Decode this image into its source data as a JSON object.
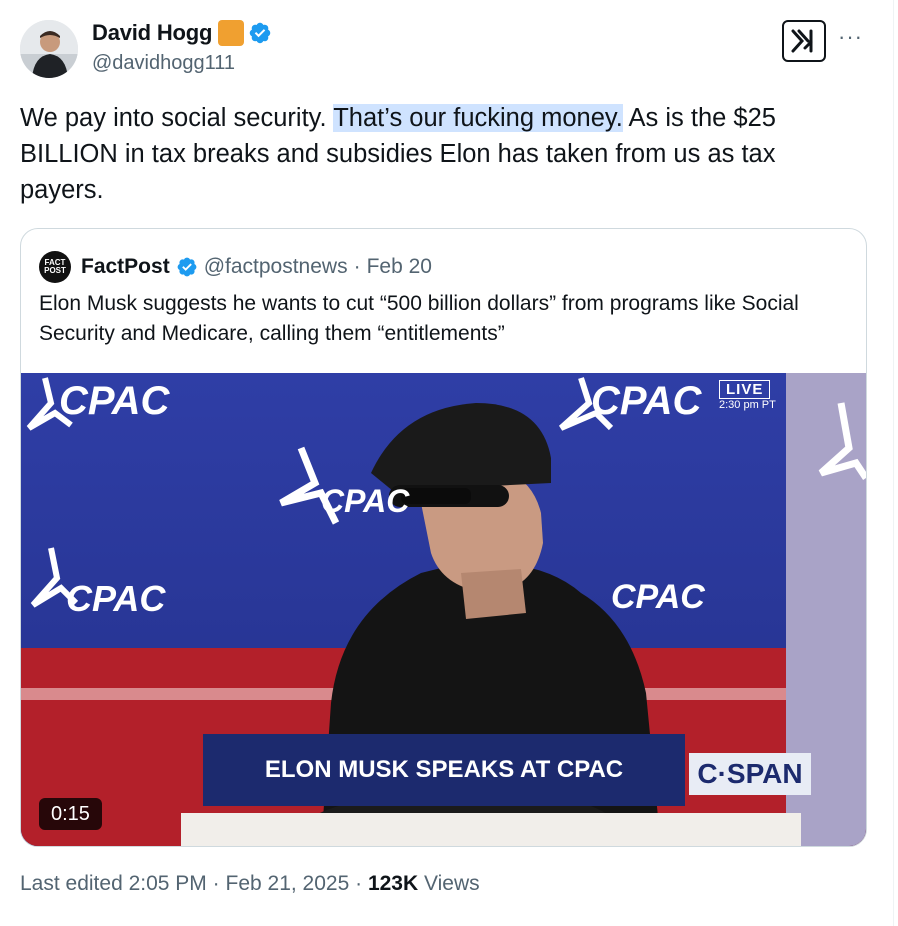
{
  "author": {
    "display_name": "David Hogg",
    "handle": "@davidhogg111",
    "verified_icon": "verified-badge-icon",
    "badge_color": "#F0A030",
    "verified_color": "#1D9BF0"
  },
  "tweet": {
    "text_before": "We pay into social security. ",
    "text_highlight": "That’s our fucking money.",
    "text_after": " As is the $25 BILLION in tax breaks and subsidies Elon has taken from us as tax payers."
  },
  "quote": {
    "avatar_text_1": "FACT",
    "avatar_text_2": "POST",
    "name": "FactPost",
    "handle": "@factpostnews",
    "date": "Feb 20",
    "separator": "·",
    "text": "Elon Musk suggests he wants to cut “500 billion dollars” from programs like Social Security and Medicare, calling them “entitlements”"
  },
  "video": {
    "logo_text": "CPAC",
    "live_label": "LIVE",
    "live_time": "2:30 pm PT",
    "chyron": "ELON MUSK SPEAKS AT CPAC",
    "network": "C·SPAN",
    "duration": "0:15"
  },
  "footer": {
    "edited_label": "Last edited",
    "time": "2:05 PM",
    "date": "Feb 21, 2025",
    "views_count": "123K",
    "views_label": "Views",
    "separator": "·"
  },
  "header": {
    "grok_icon": "grok-icon",
    "more_label": "···"
  },
  "colors": {
    "text": "#0F1419",
    "muted": "#536471",
    "highlight": "#CFE3FF",
    "border": "#CFD9DE"
  }
}
